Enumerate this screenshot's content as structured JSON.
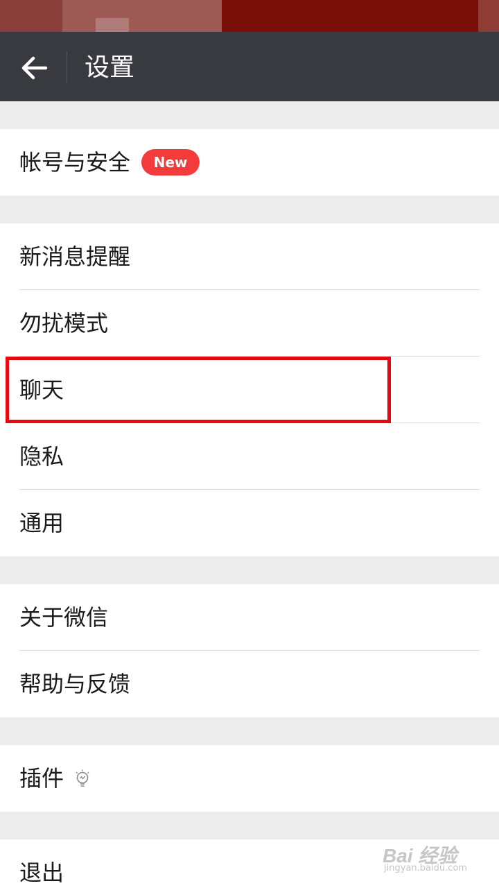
{
  "header": {
    "title": "设置"
  },
  "sections": [
    {
      "items": [
        {
          "label": "帐号与安全",
          "badge": "New"
        }
      ]
    },
    {
      "items": [
        {
          "label": "新消息提醒"
        },
        {
          "label": "勿扰模式"
        },
        {
          "label": "聊天"
        },
        {
          "label": "隐私"
        },
        {
          "label": "通用"
        }
      ]
    },
    {
      "items": [
        {
          "label": "关于微信"
        },
        {
          "label": "帮助与反馈"
        }
      ]
    },
    {
      "items": [
        {
          "label": "插件",
          "icon": "lightbulb-icon"
        }
      ]
    },
    {
      "items": [
        {
          "label": "退出"
        }
      ]
    }
  ],
  "watermark": {
    "main": "Bai 经验",
    "url": "jingyan.baidu.com"
  },
  "colors": {
    "toolbar": "#393a3f",
    "badge": "#f43b3b",
    "highlight": "#e4090e",
    "background": "#ececec"
  }
}
